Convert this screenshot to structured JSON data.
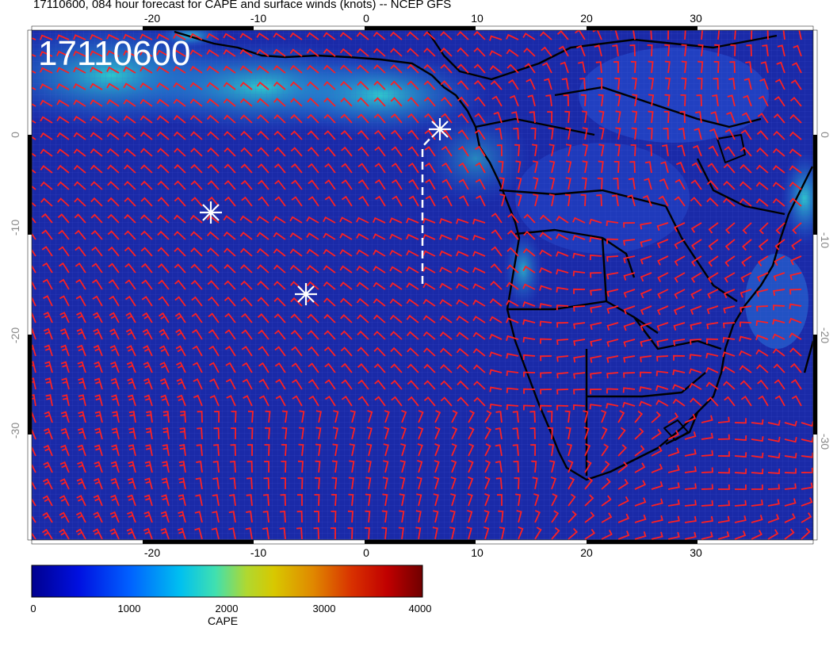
{
  "title": "17110600, 084 hour forecast for CAPE and surface winds (knots) -- NCEP GFS",
  "time_label": "17110600",
  "map": {
    "type": "weather-forecast-map",
    "field": "CAPE",
    "overlay": "surface wind barbs (knots)",
    "lon_range": [
      -30,
      41
    ],
    "lat_range": [
      -41,
      6
    ],
    "lon_ticks": [
      "-20",
      "-10",
      "0",
      "10",
      "20",
      "30"
    ],
    "lat_ticks": [
      "0",
      "-10",
      "-20",
      "-30"
    ],
    "markers": [
      {
        "type": "star",
        "lon": -14.2,
        "lat": -8.3
      },
      {
        "type": "star",
        "lon": -5.5,
        "lat": -16.1
      },
      {
        "type": "star",
        "lon": 6.7,
        "lat": 0.3
      }
    ],
    "track": {
      "style": "dashed",
      "color": "#ffffff",
      "points": [
        [
          5.2,
          -15.2
        ],
        [
          5.2,
          -1.0
        ],
        [
          6.7,
          0.3
        ]
      ]
    }
  },
  "colorbar": {
    "label": "CAPE",
    "min": 0,
    "max": 4000,
    "ticks": [
      "0",
      "1000",
      "2000",
      "3000",
      "4000"
    ],
    "colors": [
      "#00008f",
      "#0020ff",
      "#00a0ff",
      "#20e0d0",
      "#a0e050",
      "#d8d000",
      "#e89000",
      "#e03000",
      "#c00000",
      "#800000"
    ]
  },
  "colors": {
    "ocean": "#1a2aa8",
    "wind_barbs": "#ff2020",
    "land_lines": "#000000",
    "text_overlay": "#ffffff"
  }
}
